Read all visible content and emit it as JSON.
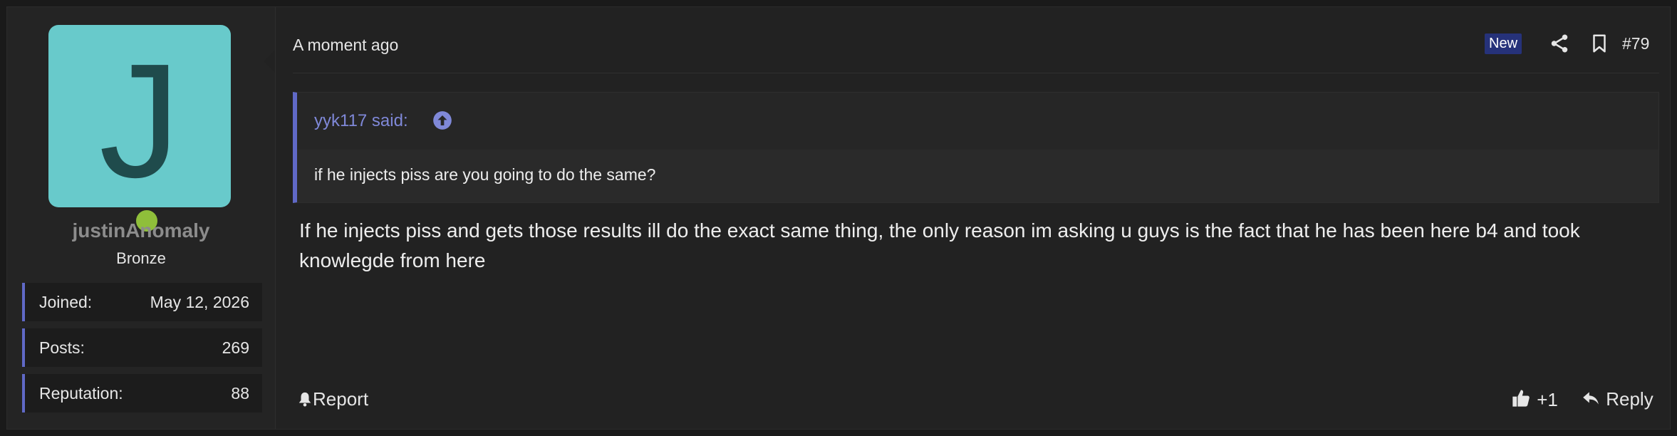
{
  "user": {
    "avatar_letter": "J",
    "username": "justinAnomaly",
    "rank": "Bronze",
    "stats": [
      {
        "label": "Joined:",
        "value": "May 12, 2026"
      },
      {
        "label": "Posts:",
        "value": "269"
      },
      {
        "label": "Reputation:",
        "value": "88"
      }
    ],
    "online": true
  },
  "post": {
    "timestamp": "A moment ago",
    "new_badge": "New",
    "number": "#79",
    "header_icons": [
      "share-icon",
      "bookmark-icon"
    ],
    "quote": {
      "author_line": "yyk117 said:",
      "text": "if he injects piss are you going to do the same?"
    },
    "message": "If he injects piss and gets those results ill do the exact same thing, the only reason im asking u guys is the fact that he has been here b4 and took knowlegde from here",
    "actions": {
      "report": "Report",
      "like": "+1",
      "reply": "Reply"
    }
  },
  "colors": {
    "accent": "#6069c7",
    "avatar_bg": "#68cacb",
    "badge_bg": "#26327a",
    "online": "#8fbf3a"
  }
}
